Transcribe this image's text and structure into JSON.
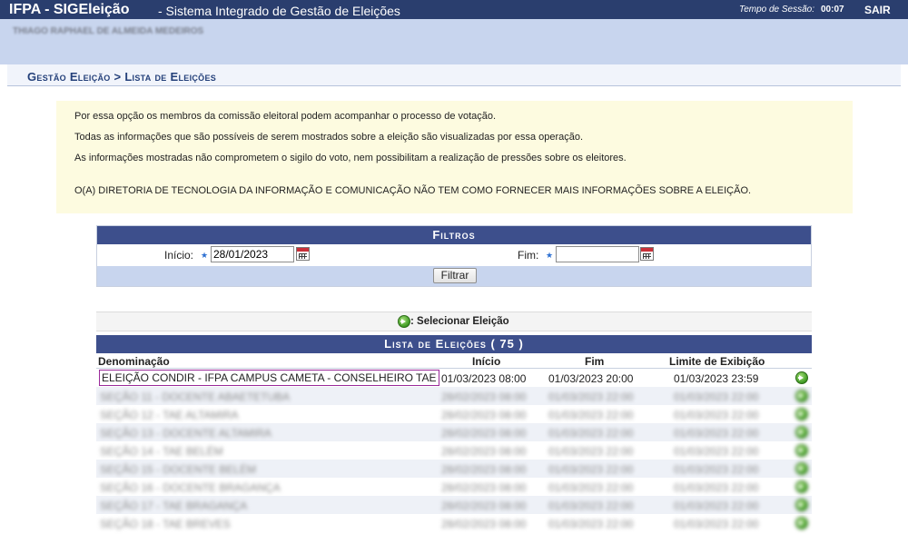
{
  "topbar": {
    "system": "IFPA - SIGEleição",
    "subtitle": "- Sistema Integrado de Gestão de Eleições",
    "session_label": "Tempo de Sessão:",
    "session_time": "00:07",
    "logout": "SAIR"
  },
  "user": {
    "name": "THIAGO RAPHAEL DE ALMEIDA MEDEIROS"
  },
  "breadcrumb": "Gestão Eleição > Lista de Eleições",
  "info": {
    "lines": [
      "Por essa opção os membros da comissão eleitoral podem acompanhar o processo de votação.",
      "Todas as informações que são possíveis de serem mostrados sobre a eleição são visualizadas por essa operação.",
      "As informações mostradas não comprometem o sigilo do voto, nem possibilitam a realização de pressões sobre os eleitores.",
      "O(A) DIRETORIA DE TECNOLOGIA DA INFORMAÇÃO E COMUNICAÇÃO NÃO TEM COMO FORNECER MAIS INFORMAÇÕES SOBRE A ELEIÇÃO."
    ]
  },
  "filters": {
    "title": "Filtros",
    "start_label": "Início:",
    "start_value": "28/01/2023",
    "end_label": "Fim:",
    "end_value": "",
    "submit": "Filtrar"
  },
  "legend": {
    "select": ": Selecionar Eleição"
  },
  "list": {
    "title": "Lista de Eleições ( 75 )",
    "columns": {
      "name": "Denominação",
      "start": "Início",
      "end": "Fim",
      "limit": "Limite de Exibição"
    },
    "rows": [
      {
        "name": "ELEIÇÃO CONDIR - IFPA CAMPUS CAMETA - CONSELHEIRO TAE",
        "start": "01/03/2023 08:00",
        "end": "01/03/2023 20:00",
        "limit": "01/03/2023 23:59"
      },
      {
        "name": "SEÇÃO 11 - DOCENTE ABAETETUBA",
        "start": "28/02/2023 08:00",
        "end": "01/03/2023 22:00",
        "limit": "01/03/2023 22:00"
      },
      {
        "name": "SEÇÃO 12 - TAE ALTAMIRA",
        "start": "28/02/2023 08:00",
        "end": "01/03/2023 22:00",
        "limit": "01/03/2023 22:00"
      },
      {
        "name": "SEÇÃO 13 - DOCENTE ALTAMIRA",
        "start": "28/02/2023 08:00",
        "end": "01/03/2023 22:00",
        "limit": "01/03/2023 22:00"
      },
      {
        "name": "SEÇÃO 14 - TAE BELÉM",
        "start": "28/02/2023 08:00",
        "end": "01/03/2023 22:00",
        "limit": "01/03/2023 22:00"
      },
      {
        "name": "SEÇÃO 15 - DOCENTE BELÉM",
        "start": "28/02/2023 08:00",
        "end": "01/03/2023 22:00",
        "limit": "01/03/2023 22:00"
      },
      {
        "name": "SEÇÃO 16 - DOCENTE BRAGANÇA",
        "start": "28/02/2023 08:00",
        "end": "01/03/2023 22:00",
        "limit": "01/03/2023 22:00"
      },
      {
        "name": "SEÇÃO 17 - TAE BRAGANÇA",
        "start": "28/02/2023 08:00",
        "end": "01/03/2023 22:00",
        "limit": "01/03/2023 22:00"
      },
      {
        "name": "SEÇÃO 18 - TAE BREVES",
        "start": "28/02/2023 08:00",
        "end": "01/03/2023 22:00",
        "limit": "01/03/2023 22:00"
      }
    ]
  },
  "colors": {
    "header": "#2a3e6e",
    "section": "#3d4f8c",
    "userbar": "#c8d5ee",
    "infobox": "#fdfbe0",
    "highlight": "#9a2a9a"
  },
  "icons": {
    "select": "green-arrow-circle-icon",
    "calendar": "calendar-icon",
    "required": "required-star-icon"
  }
}
